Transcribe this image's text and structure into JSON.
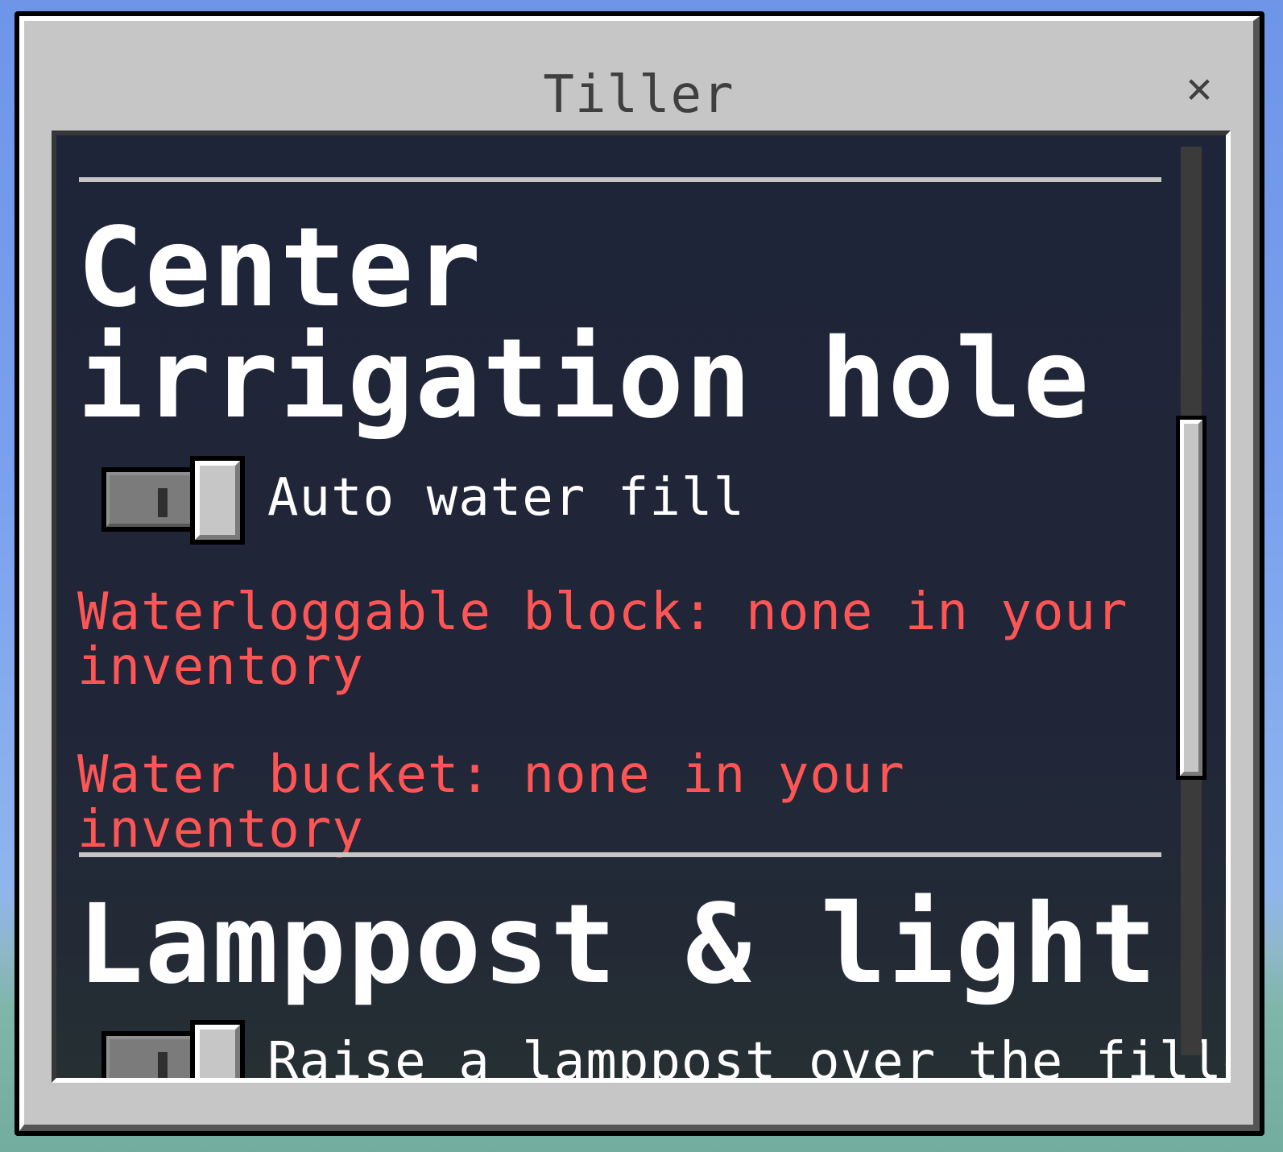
{
  "window": {
    "title": "Tiller",
    "close_icon": "close-icon",
    "close_glyph": "✕"
  },
  "sections": [
    {
      "heading": "Center irrigation hole",
      "toggle": {
        "label": "Auto water fill",
        "state": "off"
      },
      "warnings": [
        "Waterloggable block: none in your inventory",
        "Water bucket: none in your inventory"
      ]
    },
    {
      "heading": "Lamppost & light",
      "toggle": {
        "label": "Raise a lamppost over the filled",
        "state": "off"
      }
    }
  ],
  "colors": {
    "warning": "#ff5555",
    "panel_background": "#1f2538",
    "window_background": "#c6c6c6"
  }
}
